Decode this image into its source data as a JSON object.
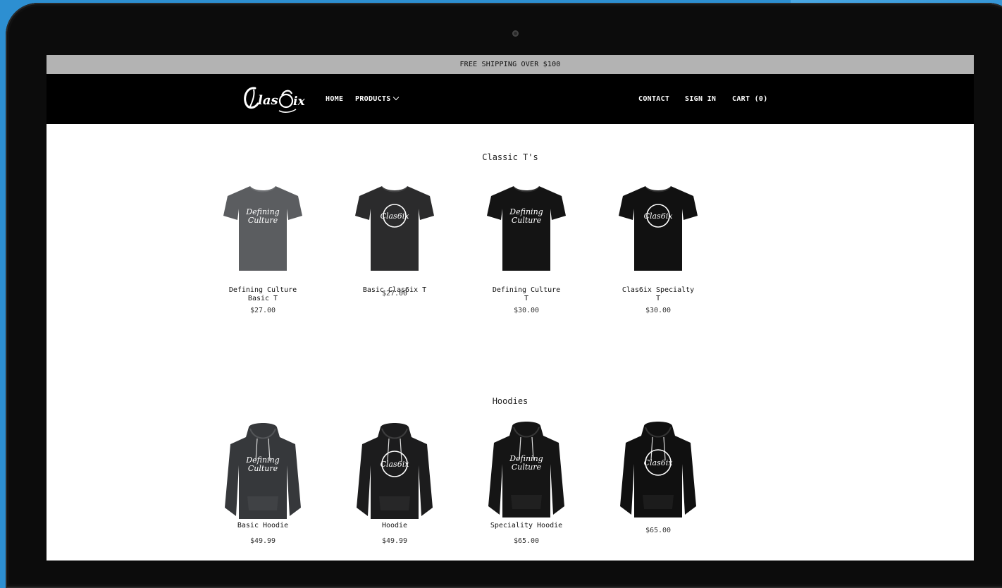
{
  "promo": {
    "text": "FREE SHIPPING OVER $100"
  },
  "brand": {
    "logo_text": "Clas6ix"
  },
  "nav": {
    "home": "HOME",
    "products": "PRODUCTS",
    "contact": "CONTACT",
    "sign_in": "SIGN IN",
    "cart": "CART (0)"
  },
  "sections": {
    "tees": {
      "title": "Classic T's",
      "items": [
        {
          "name_line1": "Defining Culture",
          "name_line2": "Basic T",
          "price": "$27.00",
          "print": "Defining Culture",
          "color": "#5b5d60"
        },
        {
          "name_line1": "Basic Clas6ix T",
          "name_line2": "",
          "price": "$27.00",
          "print": "Clas6ix",
          "color": "#2b2b2c"
        },
        {
          "name_line1": "Defining Culture",
          "name_line2": "T",
          "price": "$30.00",
          "print": "Defining Culture",
          "color": "#141414"
        },
        {
          "name_line1": "Clas6ix Specialty",
          "name_line2": "T",
          "price": "$30.00",
          "print": "Clas6ix",
          "color": "#111111"
        }
      ]
    },
    "hoodies": {
      "title": "Hoodies",
      "items": [
        {
          "name": "Basic Hoodie",
          "price": "$49.99",
          "print": "Defining Culture",
          "color": "#36383b"
        },
        {
          "name": "Hoodie",
          "price": "$49.99",
          "print": "Clas6ix",
          "color": "#1c1c1d"
        },
        {
          "name": "Speciality Hoodie",
          "price": "$65.00",
          "print": "Defining Culture",
          "color": "#151515"
        },
        {
          "name": "",
          "price": "$65.00",
          "print": "Clas6ix",
          "color": "#101010"
        }
      ]
    }
  }
}
